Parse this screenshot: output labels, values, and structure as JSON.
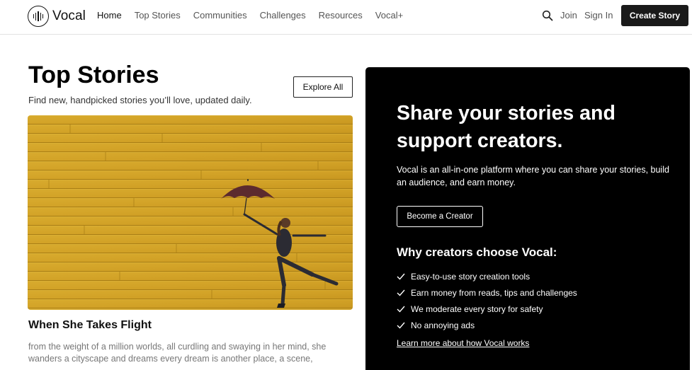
{
  "brand": {
    "name": "Vocal",
    "icon": "vocal-logo-icon"
  },
  "nav": {
    "links": [
      "Home",
      "Top Stories",
      "Communities",
      "Challenges",
      "Resources",
      "Vocal+"
    ],
    "active": "Home",
    "search_icon": "search-icon",
    "join": "Join",
    "sign_in": "Sign In",
    "create_story": "Create Story"
  },
  "top_stories": {
    "title": "Top Stories",
    "subtitle": "Find new, handpicked stories you’ll love, updated daily.",
    "explore_all": "Explore All",
    "featured": {
      "title": "When She Takes Flight",
      "excerpt": "from the weight of a million worlds, all curdling and swaying in her mind, she wanders a cityscape and dreams every dream is another place, a scene,"
    }
  },
  "promo": {
    "heading": "Share your stories and support creators.",
    "description": "Vocal is an all-in-one platform where you can share your stories, build an audience, and earn money.",
    "become_creator": "Become a Creator",
    "why_heading": "Why creators choose Vocal:",
    "reasons": [
      "Easy-to-use story creation tools",
      "Earn money from reads, tips and challenges",
      "We moderate every story for safety",
      "No annoying ads"
    ],
    "learn_more": "Learn more about how Vocal works"
  },
  "colors": {
    "primary_button": "#1a1a1a",
    "promo_bg": "#000000",
    "image_yellow": "#d4a62a"
  }
}
